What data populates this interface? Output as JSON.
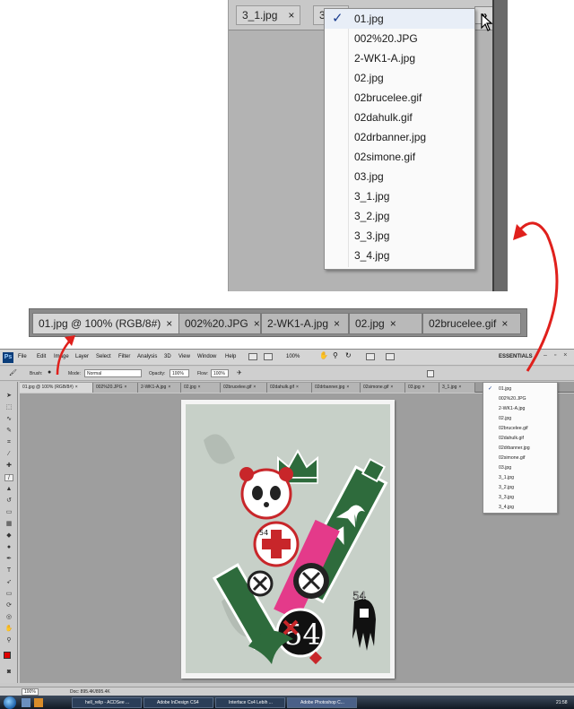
{
  "zoom_top": {
    "tabs": [
      {
        "label": "3_1.jpg"
      },
      {
        "label": "3"
      }
    ],
    "overflow_button": "»",
    "menu_items": [
      {
        "label": "01.jpg",
        "checked": true
      },
      {
        "label": "002%20.JPG"
      },
      {
        "label": "2-WK1-A.jpg"
      },
      {
        "label": "02.jpg"
      },
      {
        "label": "02brucelee.gif"
      },
      {
        "label": "02dahulk.gif"
      },
      {
        "label": "02drbanner.jpg"
      },
      {
        "label": "02simone.gif"
      },
      {
        "label": "03.jpg"
      },
      {
        "label": "3_1.jpg"
      },
      {
        "label": "3_2.jpg"
      },
      {
        "label": "3_3.jpg"
      },
      {
        "label": "3_4.jpg"
      }
    ]
  },
  "zoom_tabs": {
    "tabs": [
      {
        "label": "01.jpg @ 100% (RGB/8#)",
        "active": true
      },
      {
        "label": "002%20.JPG"
      },
      {
        "label": "2-WK1-A.jpg"
      },
      {
        "label": "02.jpg"
      },
      {
        "label": "02brucelee.gif"
      }
    ],
    "close_glyph": "×"
  },
  "ps": {
    "logo": "Ps",
    "menus": [
      "File",
      "Edit",
      "Image",
      "Layer",
      "Select",
      "Filter",
      "Analysis",
      "3D",
      "View",
      "Window",
      "Help"
    ],
    "zoom_level": "100%",
    "workspace": "ESSENTIALS",
    "window_buttons": "– ▫ ×",
    "options": {
      "brush_label": "Brush:",
      "mode_label": "Mode:",
      "mode_value": "Normal",
      "opacity_label": "Opacity:",
      "opacity_value": "100%",
      "flow_label": "Flow:",
      "flow_value": "100%"
    },
    "doc_tabs": [
      {
        "label": "01.jpg @ 100% (RGB/8#)",
        "active": true
      },
      {
        "label": "002%20.JPG"
      },
      {
        "label": "2-WK1-A.jpg"
      },
      {
        "label": "02.jpg"
      },
      {
        "label": "02brucelee.gif"
      },
      {
        "label": "02dahulk.gif"
      },
      {
        "label": "02drbanner.jpg"
      },
      {
        "label": "02simone.gif"
      },
      {
        "label": "03.jpg"
      },
      {
        "label": "3_1.jpg"
      }
    ],
    "tab_menu_items": [
      {
        "label": "01.jpg",
        "checked": true
      },
      {
        "label": "002%20.JPG"
      },
      {
        "label": "2-WK1-A.jpg"
      },
      {
        "label": "02.jpg"
      },
      {
        "label": "02brucelee.gif"
      },
      {
        "label": "02dahulk.gif"
      },
      {
        "label": "02drbanner.jpg"
      },
      {
        "label": "02simone.gif"
      },
      {
        "label": "03.jpg"
      },
      {
        "label": "3_1.jpg"
      },
      {
        "label": "3_2.jpg"
      },
      {
        "label": "3_3.jpg"
      },
      {
        "label": "3_4.jpg"
      }
    ],
    "status": {
      "zoom": "100%",
      "doc": "Doc: 895.4K/895.4K"
    },
    "taskbar": [
      {
        "label": "hell_relip - ACDSee ..."
      },
      {
        "label": "Adobe InDesign CS4"
      },
      {
        "label": "Interface Cs4 Lebih ..."
      },
      {
        "label": "Adobe Photoshop C...",
        "active": true
      }
    ],
    "clock": "21:58",
    "artwork_text": {
      "num_big": "54",
      "num_small": "54",
      "num_tiny": "54"
    }
  },
  "colors": {
    "arrow": "#e0201c",
    "foreground_swatch": "#e00000",
    "green": "#2e6b3c",
    "red": "#c8262a",
    "pink": "#e43a8a"
  }
}
